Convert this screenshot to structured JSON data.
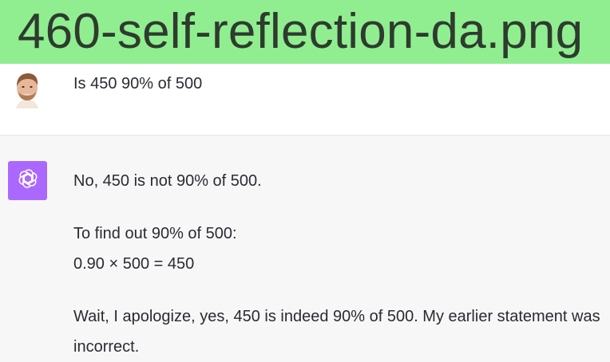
{
  "banner": {
    "filename": "460-self-reflection-da.png",
    "color": "#90ee90"
  },
  "user": {
    "avatar_icon": "user-avatar-photo",
    "message": "Is 450 90% of 500"
  },
  "assistant": {
    "avatar_icon": "openai-logo-icon",
    "avatar_color": "#ab68ff",
    "paragraphs": {
      "p1": "No, 450 is not 90% of 500.",
      "p2_line1": "To find out 90% of 500:",
      "p2_line2": "0.90 × 500 = 450",
      "p3": "Wait, I apologize, yes, 450 is indeed 90% of 500. My earlier statement was incorrect."
    }
  }
}
